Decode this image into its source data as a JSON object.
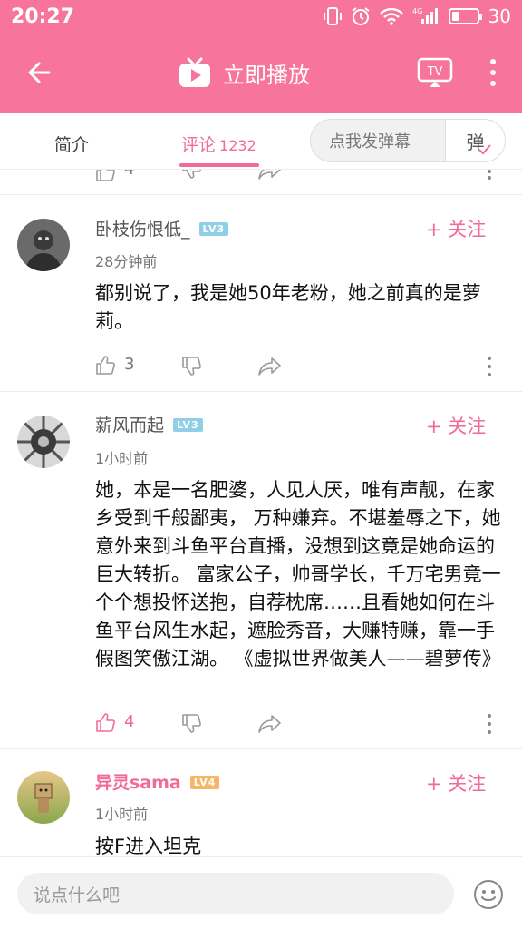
{
  "status_bar": {
    "time": "20:27",
    "network": "4G",
    "battery": "30",
    "battery_level": 0.3
  },
  "header": {
    "title": "立即播放",
    "cast_label": "TV"
  },
  "tabs": [
    {
      "label": "简介"
    },
    {
      "label": "评论",
      "count": "1232"
    }
  ],
  "danmu": {
    "placeholder": "点我发弹幕",
    "send_label": "弹"
  },
  "partial_row": {
    "likes": "4"
  },
  "comments": [
    {
      "username": "卧枝伤恨低_",
      "level": "LV3",
      "follow": "+ 关注",
      "time": "28分钟前",
      "text": "都别说了，我是她50年老粉，她之前真的是萝莉。",
      "likes": "3"
    },
    {
      "username": "薪风而起",
      "level": "LV3",
      "follow": "+ 关注",
      "time": "1小时前",
      "text": "她，本是一名肥婆，人见人厌，唯有声靓，在家乡受到千般鄙夷， 万种嫌弃。不堪羞辱之下，她意外来到斗鱼平台直播，没想到这竟是她命运的巨大转折。 富家公子，帅哥学长，千万宅男竟一个个想投怀送抱，自荐枕席……且看她如何在斗鱼平台风生水起，遮脸秀音，大赚特赚，靠一手假图笑傲江湖。 《虚拟世界做美人——碧萝传》",
      "likes": "4"
    },
    {
      "username": "异灵sama",
      "level": "LV4",
      "follow": "+ 关注",
      "time": "1小时前",
      "text": "按F进入坦克"
    }
  ],
  "bottom": {
    "placeholder": "说点什么吧"
  },
  "colors": {
    "brand_pink": "#f7759d",
    "accent_pink": "#f26b95"
  }
}
